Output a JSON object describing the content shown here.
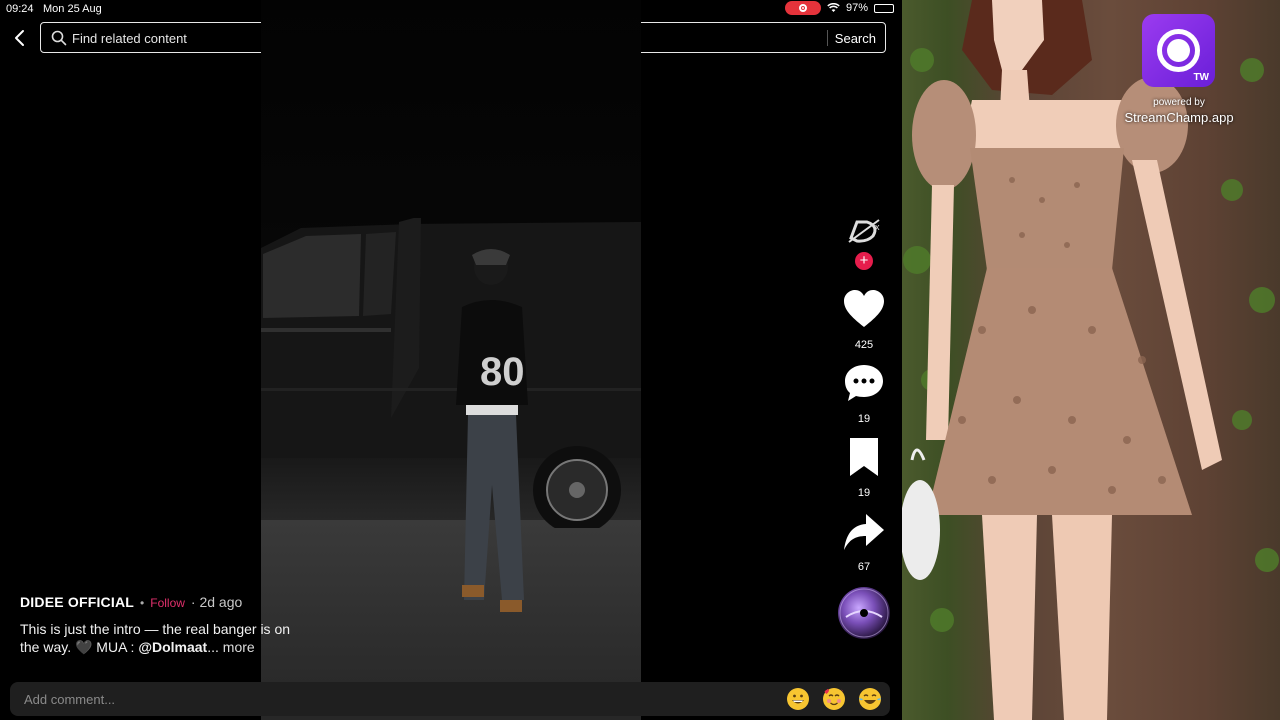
{
  "status_bar": {
    "time": "09:24",
    "date": "Mon 25 Aug",
    "battery": "97%",
    "battery_level": 0.97,
    "recording_color": "#e5333b"
  },
  "search": {
    "back_icon": "chevron-left-icon",
    "placeholder": "Find related content",
    "button_label": "Search"
  },
  "post": {
    "creator": "DIDEE OFFICIAL",
    "follow_label": "Follow",
    "separator": "•",
    "age": "· 2d ago",
    "caption_text": "This is just the intro — the real banger is on the way. 🖤 MUA : ",
    "mention": "@Dolmaat",
    "ellipsis": "... ",
    "more_label": "more"
  },
  "actions": {
    "follow_plus": "+",
    "likes": "425",
    "comments": "19",
    "saves": "19",
    "shares": "67",
    "accent_color": "#e61d4c"
  },
  "comment": {
    "placeholder": "Add comment..."
  },
  "emojis": [
    "grinning-face",
    "smiling-face-with-hearts",
    "face-with-tears-of-joy"
  ],
  "overlay": {
    "badge": "TW",
    "powered_by": "powered by",
    "site": "StreamChamp.app"
  }
}
